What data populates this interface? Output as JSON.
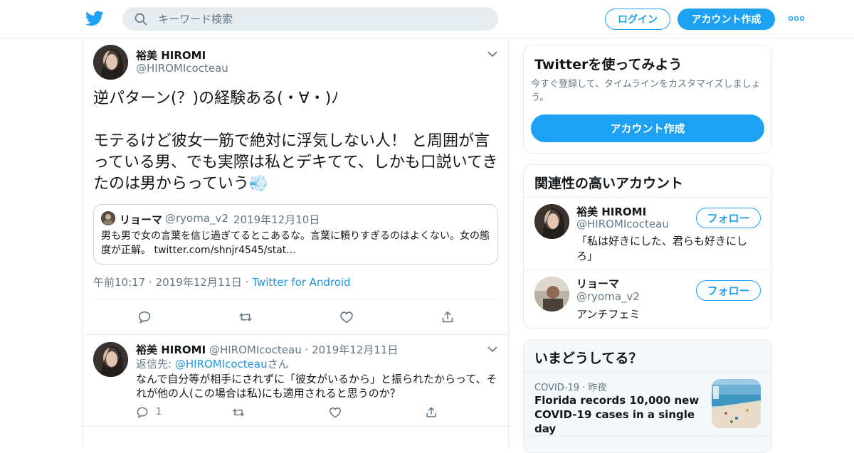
{
  "header": {
    "search_placeholder": "キーワード検索",
    "login_label": "ログイン",
    "signup_label": "アカウント作成"
  },
  "tweet": {
    "name": "裕美 HIROMI",
    "handle": "@HIROMIcocteau",
    "text": "逆パターン(？)の経験ある(・∀・)ﾉ\n\nモテるけど彼女一筋で絶対に浮気しない人！ と周囲が言っている男、でも実際は私とデキてて、しかも口説いてきたのは男からっていう💨",
    "quote": {
      "name": "リョーマ",
      "handle": "@ryoma_v2",
      "date": "2019年12月10日",
      "text": "男も男で女の言葉を信じ過ぎてるとこあるな。言葉に頼りすぎるのはよくない。女の態度が正解。 twitter.com/shnjr4545/stat..."
    },
    "time": "午前10:17",
    "date": "2019年12月11日",
    "client": "Twitter for Android"
  },
  "reply": {
    "name": "裕美 HIROMI",
    "handle": "@HIROMIcocteau",
    "date": "2019年12月11日",
    "reply_to_prefix": "返信先: ",
    "reply_to_handle": "@HIROMIcocteau",
    "reply_to_suffix": "さん",
    "text": "なんで自分等が相手にされずに「彼女がいるから」と振られたからって、それが他の人(この場合は私)にも適用されると思うのか？",
    "reply_count": "1"
  },
  "signup_card": {
    "title": "Twitterを使ってみよう",
    "subtitle": "今すぐ登録して、タイムラインをカスタマイズしましょう。",
    "button": "アカウント作成"
  },
  "related": {
    "title": "関連性の高いアカウント",
    "accounts": [
      {
        "name": "裕美 HIROMI",
        "handle": "@HIROMIcocteau",
        "bio": "「私は好きにした、君らも好きにしろ」",
        "follow": "フォロー"
      },
      {
        "name": "リョーマ",
        "handle": "@ryoma_v2",
        "bio": "アンチフェミ",
        "follow": "フォロー"
      }
    ]
  },
  "trends": {
    "title": "いまどうしてる？",
    "item": {
      "category": "COVID-19",
      "when": "昨夜",
      "headline": "Florida records 10,000 new COVID-19 cases in a single day"
    }
  },
  "colors": {
    "accent": "#1da1f2",
    "link": "#1b95e0",
    "muted": "#657786",
    "border": "#e6ecf0"
  },
  "icons": [
    "twitter-logo-icon",
    "search-icon",
    "more-icon",
    "chevron-down-icon",
    "reply-icon",
    "retweet-icon",
    "like-icon",
    "share-icon"
  ]
}
